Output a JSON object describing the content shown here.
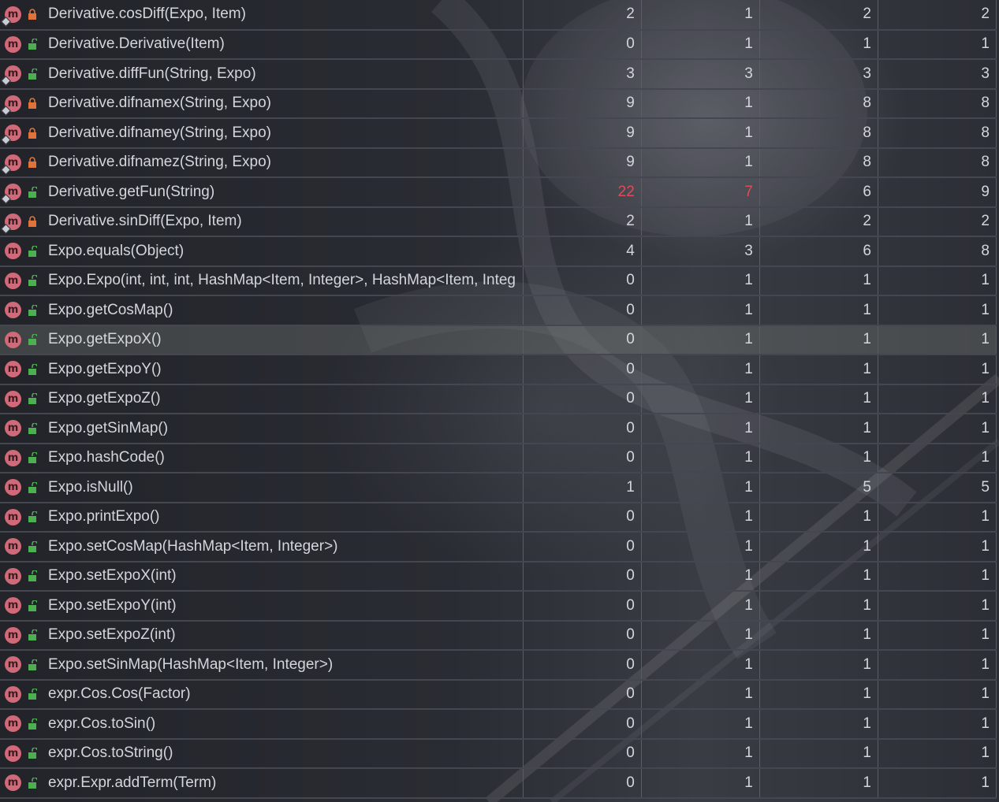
{
  "colors": {
    "warning_value": "#e24a5a",
    "method_icon": "#d06a78",
    "lock_private": "#e0733a",
    "lock_public": "#4caf50"
  },
  "rows": [
    {
      "name": "Derivative.cosDiff(Expo, Item)",
      "access": "private",
      "pinned": true,
      "values": [
        "2",
        "1",
        "2",
        "2"
      ]
    },
    {
      "name": "Derivative.Derivative(Item)",
      "access": "public",
      "pinned": false,
      "values": [
        "0",
        "1",
        "1",
        "1"
      ]
    },
    {
      "name": "Derivative.diffFun(String, Expo)",
      "access": "public",
      "pinned": true,
      "values": [
        "3",
        "3",
        "3",
        "3"
      ]
    },
    {
      "name": "Derivative.difnamex(String, Expo)",
      "access": "private",
      "pinned": true,
      "values": [
        "9",
        "1",
        "8",
        "8"
      ]
    },
    {
      "name": "Derivative.difnamey(String, Expo)",
      "access": "private",
      "pinned": true,
      "values": [
        "9",
        "1",
        "8",
        "8"
      ]
    },
    {
      "name": "Derivative.difnamez(String, Expo)",
      "access": "private",
      "pinned": true,
      "values": [
        "9",
        "1",
        "8",
        "8"
      ]
    },
    {
      "name": "Derivative.getFun(String)",
      "access": "public",
      "pinned": true,
      "values": [
        "22",
        "7",
        "6",
        "9"
      ],
      "warn": [
        true,
        true,
        false,
        false
      ]
    },
    {
      "name": "Derivative.sinDiff(Expo, Item)",
      "access": "private",
      "pinned": true,
      "values": [
        "2",
        "1",
        "2",
        "2"
      ]
    },
    {
      "name": "Expo.equals(Object)",
      "access": "public",
      "pinned": false,
      "values": [
        "4",
        "3",
        "6",
        "8"
      ]
    },
    {
      "name": "Expo.Expo(int, int, int, HashMap<Item, Integer>, HashMap<Item, Integ",
      "access": "public",
      "pinned": false,
      "values": [
        "0",
        "1",
        "1",
        "1"
      ]
    },
    {
      "name": "Expo.getCosMap()",
      "access": "public",
      "pinned": false,
      "values": [
        "0",
        "1",
        "1",
        "1"
      ]
    },
    {
      "name": "Expo.getExpoX()",
      "access": "public",
      "pinned": false,
      "values": [
        "0",
        "1",
        "1",
        "1"
      ],
      "selected": true
    },
    {
      "name": "Expo.getExpoY()",
      "access": "public",
      "pinned": false,
      "values": [
        "0",
        "1",
        "1",
        "1"
      ]
    },
    {
      "name": "Expo.getExpoZ()",
      "access": "public",
      "pinned": false,
      "values": [
        "0",
        "1",
        "1",
        "1"
      ]
    },
    {
      "name": "Expo.getSinMap()",
      "access": "public",
      "pinned": false,
      "values": [
        "0",
        "1",
        "1",
        "1"
      ]
    },
    {
      "name": "Expo.hashCode()",
      "access": "public",
      "pinned": false,
      "values": [
        "0",
        "1",
        "1",
        "1"
      ]
    },
    {
      "name": "Expo.isNull()",
      "access": "public",
      "pinned": false,
      "values": [
        "1",
        "1",
        "5",
        "5"
      ]
    },
    {
      "name": "Expo.printExpo()",
      "access": "public",
      "pinned": false,
      "values": [
        "0",
        "1",
        "1",
        "1"
      ]
    },
    {
      "name": "Expo.setCosMap(HashMap<Item, Integer>)",
      "access": "public",
      "pinned": false,
      "values": [
        "0",
        "1",
        "1",
        "1"
      ]
    },
    {
      "name": "Expo.setExpoX(int)",
      "access": "public",
      "pinned": false,
      "values": [
        "0",
        "1",
        "1",
        "1"
      ]
    },
    {
      "name": "Expo.setExpoY(int)",
      "access": "public",
      "pinned": false,
      "values": [
        "0",
        "1",
        "1",
        "1"
      ]
    },
    {
      "name": "Expo.setExpoZ(int)",
      "access": "public",
      "pinned": false,
      "values": [
        "0",
        "1",
        "1",
        "1"
      ]
    },
    {
      "name": "Expo.setSinMap(HashMap<Item, Integer>)",
      "access": "public",
      "pinned": false,
      "values": [
        "0",
        "1",
        "1",
        "1"
      ]
    },
    {
      "name": "expr.Cos.Cos(Factor)",
      "access": "public",
      "pinned": false,
      "values": [
        "0",
        "1",
        "1",
        "1"
      ]
    },
    {
      "name": "expr.Cos.toSin()",
      "access": "public",
      "pinned": false,
      "values": [
        "0",
        "1",
        "1",
        "1"
      ]
    },
    {
      "name": "expr.Cos.toString()",
      "access": "public",
      "pinned": false,
      "values": [
        "0",
        "1",
        "1",
        "1"
      ]
    },
    {
      "name": "expr.Expr.addTerm(Term)",
      "access": "public",
      "pinned": false,
      "values": [
        "0",
        "1",
        "1",
        "1"
      ]
    }
  ]
}
